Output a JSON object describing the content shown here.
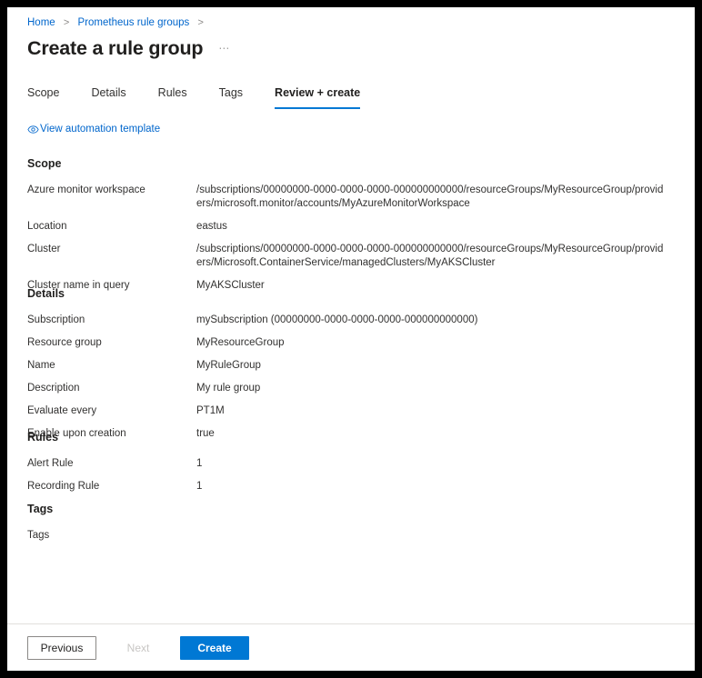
{
  "breadcrumb": {
    "items": [
      "Home",
      "Prometheus rule groups"
    ],
    "separator": ">"
  },
  "header": {
    "title": "Create a rule group",
    "ellipsis": "⋯"
  },
  "tabs": [
    {
      "label": "Scope",
      "active": false
    },
    {
      "label": "Details",
      "active": false
    },
    {
      "label": "Rules",
      "active": false
    },
    {
      "label": "Tags",
      "active": false
    },
    {
      "label": "Review + create",
      "active": true
    }
  ],
  "automation_link": {
    "label": "View automation template",
    "icon": "eye-icon"
  },
  "sections": [
    {
      "heading": "Scope",
      "rows": [
        {
          "key": "Azure monitor workspace",
          "value": "/subscriptions/00000000-0000-0000-0000-000000000000/resourceGroups/MyResourceGroup/providers/microsoft.monitor/accounts/MyAzureMonitorWorkspace"
        },
        {
          "key": "Location",
          "value": "eastus"
        },
        {
          "key": "Cluster",
          "value": "/subscriptions/00000000-0000-0000-0000-000000000000/resourceGroups/MyResourceGroup/providers/Microsoft.ContainerService/managedClusters/MyAKSCluster"
        },
        {
          "key": "Cluster name in query",
          "value": "MyAKSCluster"
        }
      ]
    },
    {
      "heading": "Details",
      "rows": [
        {
          "key": "Subscription",
          "value": "mySubscription (00000000-0000-0000-0000-000000000000)"
        },
        {
          "key": "Resource group",
          "value": "MyResourceGroup"
        },
        {
          "key": "Name",
          "value": "MyRuleGroup"
        },
        {
          "key": "Description",
          "value": "My rule group"
        },
        {
          "key": "Evaluate every",
          "value": "PT1M"
        },
        {
          "key": "Enable upon creation",
          "value": "true"
        }
      ]
    },
    {
      "heading": "Rules",
      "rows": [
        {
          "key": "Alert Rule",
          "value": "1"
        },
        {
          "key": "Recording Rule",
          "value": "1"
        }
      ]
    },
    {
      "heading": "Tags",
      "rows": [
        {
          "key": "Tags",
          "value": ""
        }
      ]
    }
  ],
  "footer": {
    "previous_label": "Previous",
    "next_label": "Next",
    "create_label": "Create"
  },
  "colors": {
    "accent": "#0078d4",
    "link": "#0066cc",
    "text": "#323130",
    "heading": "#201f1e",
    "disabled": "#c8c6c4",
    "divider": "#e1dfdd"
  }
}
